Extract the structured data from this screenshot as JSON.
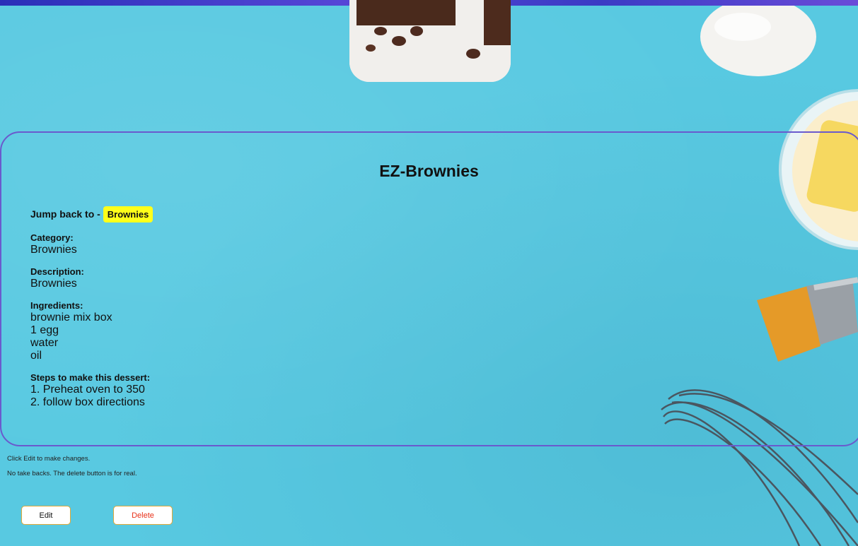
{
  "recipe": {
    "title": "EZ-Brownies",
    "jump_label": "Jump back to -",
    "jump_link": "Brownies",
    "category_label": "Category:",
    "category_value": "Brownies",
    "description_label": "Description:",
    "description_value": "Brownies",
    "ingredients_label": "Ingredients:",
    "ingredients": [
      "brownie mix box",
      "1 egg",
      "water",
      "oil"
    ],
    "steps_label": "Steps to make this dessert:",
    "steps": [
      "1. Preheat oven to 350",
      "2. follow box directions"
    ]
  },
  "notes": {
    "edit_hint": "Click Edit to make changes.",
    "delete_warning": "No take backs. The delete button is for real."
  },
  "actions": {
    "edit_label": "Edit",
    "delete_label": "Delete"
  },
  "colors": {
    "background": "#58c9e1",
    "card_border": "#6a5acd",
    "jump_highlight": "#ffff1a",
    "delete_text": "#e8321a",
    "button_border": "#e0a838"
  }
}
